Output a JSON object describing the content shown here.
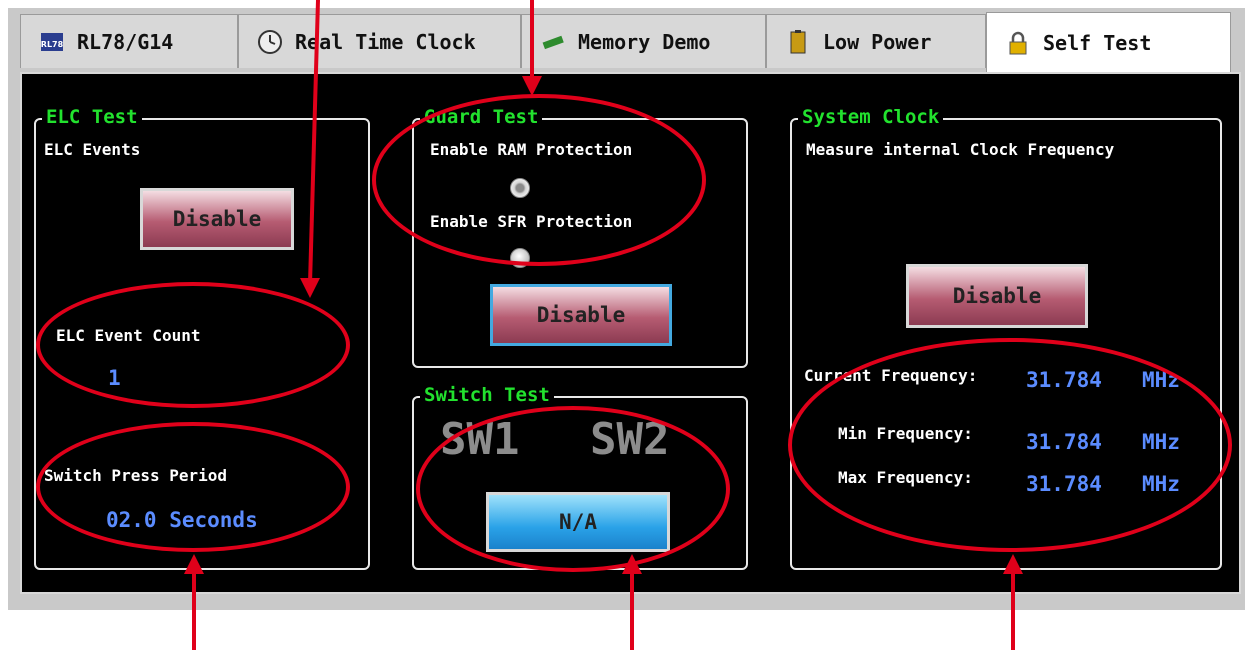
{
  "tabs": [
    {
      "label": "RL78/G14",
      "icon": "chip-icon"
    },
    {
      "label": "Real Time Clock",
      "icon": "clock-icon"
    },
    {
      "label": "Memory Demo",
      "icon": "memory-icon"
    },
    {
      "label": "Low Power",
      "icon": "battery-icon"
    },
    {
      "label": "Self Test",
      "icon": "lock-icon",
      "active": true
    }
  ],
  "elc": {
    "title": "ELC Test",
    "events_label": "ELC Events",
    "button": "Disable",
    "count_label": "ELC Event Count",
    "count_value": "1",
    "press_label": "Switch Press Period",
    "press_value": "02.0 Seconds"
  },
  "guard": {
    "title": "Guard Test",
    "ram_label": "Enable RAM Protection",
    "sfr_label": "Enable SFR Protection",
    "button": "Disable"
  },
  "switch": {
    "title": "Switch Test",
    "sw1": "SW1",
    "sw2": "SW2",
    "button": "N/A"
  },
  "clock": {
    "title": "System Clock",
    "subtitle": "Measure internal Clock Frequency",
    "button": "Disable",
    "current_label": "Current Frequency:",
    "current_value": "31.784",
    "min_label": "Min Frequency:",
    "min_value": "31.784",
    "max_label": "Max Frequency:",
    "max_value": "31.784",
    "unit": "MHz"
  },
  "colors": {
    "accent_green": "#22e22e",
    "value_blue": "#5b8cff",
    "annotation_red": "#e0001a"
  }
}
